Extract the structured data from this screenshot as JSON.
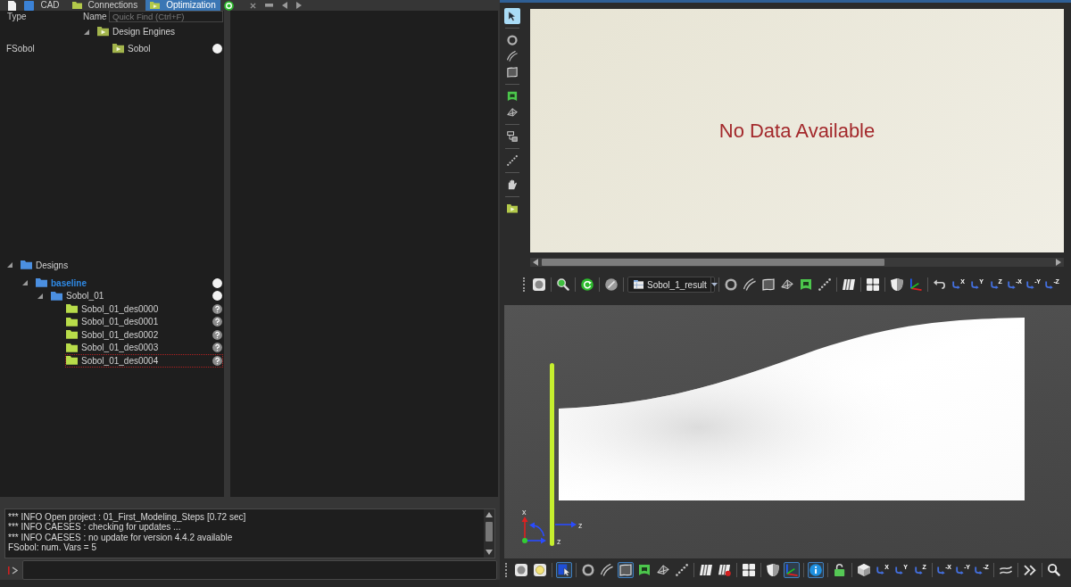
{
  "left_tabs": {
    "tabs": [
      {
        "kind": "cad",
        "label": "CAD",
        "selected": false
      },
      {
        "kind": "connections",
        "label": "Connections",
        "selected": false
      },
      {
        "kind": "optimization",
        "label": "Optimization",
        "selected": true
      }
    ]
  },
  "engine_tree": {
    "columns": [
      "Type",
      "Name"
    ],
    "search": {
      "placeholder": "Quick Find (Ctrl+F)"
    },
    "items": [
      {
        "kind": "engine",
        "label": "Design Engines",
        "expanded": true,
        "children": [
          {
            "kind": "engine",
            "type": "FSobol",
            "label": "Sobol",
            "evaluated": true
          }
        ]
      }
    ]
  },
  "design_tree": {
    "items": [
      {
        "kind": "folder",
        "label": "Designs",
        "active": false,
        "focused": false,
        "expanded": true,
        "children": [
          {
            "kind": "folder",
            "label": "baseline",
            "active": true,
            "focused": false,
            "expanded": true,
            "evaluated": true,
            "children": [
              {
                "kind": "folder",
                "label": "Sobol_01",
                "active": false,
                "focused": false,
                "expanded": true,
                "evaluated": true,
                "children": [
                  {
                    "kind": "design",
                    "label": "Sobol_01_des0000",
                    "active": false,
                    "focused": false,
                    "evaluated": false
                  },
                  {
                    "kind": "design",
                    "label": "Sobol_01_des0001",
                    "active": false,
                    "focused": false,
                    "evaluated": false
                  },
                  {
                    "kind": "design",
                    "label": "Sobol_01_des0002",
                    "active": false,
                    "focused": false,
                    "evaluated": false
                  },
                  {
                    "kind": "design",
                    "label": "Sobol_01_des0003",
                    "active": false,
                    "focused": false,
                    "evaluated": false
                  },
                  {
                    "kind": "design",
                    "label": "Sobol_01_des0004",
                    "active": false,
                    "focused": true,
                    "evaluated": false
                  }
                ]
              }
            ]
          }
        ]
      }
    ]
  },
  "console": {
    "lines": [
      "*** INFO Open project : 01_First_Modeling_Steps [0.72 sec]",
      "*** INFO CAESES : checking for updates ...",
      "*** INFO CAESES : no update for version 4.4.2 available",
      "FSobol: num. Vars = 5"
    ]
  },
  "side_toolbar": {
    "groups": [
      [
        {
          "kind": "select",
          "on": true
        }
      ],
      [
        {
          "kind": "point",
          "on": false
        },
        {
          "kind": "curve",
          "on": false
        },
        {
          "kind": "surface",
          "on": false
        }
      ],
      [
        {
          "kind": "feature",
          "on": false
        },
        {
          "kind": "solid",
          "on": false
        }
      ],
      [
        {
          "kind": "tree",
          "on": false
        }
      ],
      [
        {
          "kind": "dots",
          "on": false
        }
      ],
      [
        {
          "kind": "hand",
          "on": false
        }
      ],
      [
        {
          "kind": "play",
          "on": false
        }
      ]
    ]
  },
  "result_chart": {
    "message": "No Data Available"
  },
  "result_toolbar": {
    "groups": [
      [
        {
          "kind": "sphere"
        }
      ],
      [
        {
          "kind": "zoom"
        }
      ],
      [
        {
          "kind": "refresh"
        }
      ],
      [
        {
          "kind": "disable"
        }
      ],
      [
        {
          "kind": "dropdown",
          "value": "Sobol_1_result"
        }
      ],
      [
        {
          "kind": "point"
        },
        {
          "kind": "curve"
        },
        {
          "kind": "surface"
        },
        {
          "kind": "solid"
        },
        {
          "kind": "feature"
        },
        {
          "kind": "dots"
        }
      ],
      [
        {
          "kind": "pillars"
        }
      ],
      [
        {
          "kind": "grid"
        }
      ],
      [
        {
          "kind": "shield"
        },
        {
          "kind": "axes"
        }
      ],
      [
        {
          "kind": "undo"
        },
        {
          "kind": "view",
          "label": "X"
        },
        {
          "kind": "view",
          "label": "Y"
        },
        {
          "kind": "view",
          "label": "Z"
        },
        {
          "kind": "view",
          "label": "-X"
        },
        {
          "kind": "view",
          "label": "-Y"
        },
        {
          "kind": "view",
          "label": "-Z"
        }
      ]
    ]
  },
  "view": {
    "axis_label": "z",
    "triad_labels": [
      "x",
      "z"
    ]
  },
  "view_toolbar": {
    "groups": [
      [
        {
          "kind": "sphere",
          "on": false
        },
        {
          "kind": "light",
          "on": false
        }
      ],
      [
        {
          "kind": "pick",
          "on": true
        }
      ],
      [
        {
          "kind": "point",
          "on": false
        },
        {
          "kind": "curve",
          "on": false
        },
        {
          "kind": "surface",
          "on": true
        },
        {
          "kind": "feature",
          "on": false
        },
        {
          "kind": "solid",
          "on": false
        },
        {
          "kind": "dots",
          "on": false
        }
      ],
      [
        {
          "kind": "pillars",
          "on": false
        },
        {
          "kind": "pillarsoff",
          "on": false
        }
      ],
      [
        {
          "kind": "grid",
          "on": false
        }
      ],
      [
        {
          "kind": "shield",
          "on": false
        },
        {
          "kind": "axes",
          "on": true
        }
      ],
      [
        {
          "kind": "info",
          "on": true
        }
      ],
      [
        {
          "kind": "lock",
          "on": false
        }
      ],
      [
        {
          "kind": "cube",
          "on": false
        },
        {
          "kind": "view",
          "label": "X",
          "on": false
        },
        {
          "kind": "view",
          "label": "Y",
          "on": false
        },
        {
          "kind": "view",
          "label": "Z",
          "on": false
        }
      ],
      [
        {
          "kind": "view",
          "label": "-X",
          "on": false
        },
        {
          "kind": "view",
          "label": "-Y",
          "on": false
        },
        {
          "kind": "view",
          "label": "-Z",
          "on": false
        }
      ],
      [
        {
          "kind": "wave",
          "on": false
        }
      ],
      [
        {
          "kind": "more",
          "on": false
        }
      ],
      [
        {
          "kind": "search",
          "on": false
        }
      ]
    ]
  }
}
